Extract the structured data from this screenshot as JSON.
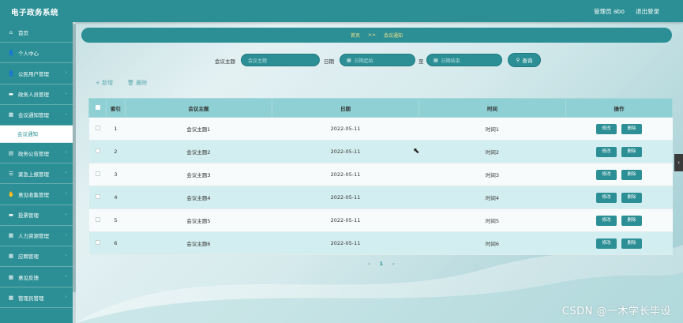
{
  "app": {
    "title": "电子政务系统",
    "admin_label": "管理员 abo",
    "logout": "退出登录"
  },
  "sidebar": {
    "items": [
      {
        "label": "首页",
        "icon": "home-icon",
        "glyph": "⌂"
      },
      {
        "label": "个人中心",
        "icon": "user-icon",
        "glyph": "👤"
      },
      {
        "label": "公民用户管理",
        "icon": "user-icon",
        "glyph": "👤"
      },
      {
        "label": "政务人员管理",
        "icon": "card-icon",
        "glyph": "▬"
      },
      {
        "label": "会议通知管理",
        "icon": "grid-icon",
        "glyph": "▦"
      },
      {
        "label": "政务公告管理",
        "icon": "book-icon",
        "glyph": "▤"
      },
      {
        "label": "紧急上报管理",
        "icon": "list-icon",
        "glyph": "☰"
      },
      {
        "label": "意见收集管理",
        "icon": "hand-icon",
        "glyph": "✋"
      },
      {
        "label": "投票管理",
        "icon": "card-icon",
        "glyph": "▬"
      },
      {
        "label": "人力资源管理",
        "icon": "grid-icon",
        "glyph": "▦"
      },
      {
        "label": "应聘管理",
        "icon": "grid-icon",
        "glyph": "▦"
      },
      {
        "label": "意见反馈",
        "icon": "grid-icon",
        "glyph": "▦"
      },
      {
        "label": "管理员管理",
        "icon": "grid-icon",
        "glyph": "▦"
      }
    ],
    "active_sub": "会议通知"
  },
  "breadcrumb": {
    "home": "首页",
    "sep": ">>",
    "current": "会议通知"
  },
  "search": {
    "topic_label": "会议主题",
    "topic_placeholder": "会议主题",
    "date_label": "日期",
    "date_start_placeholder": "日期起始",
    "to_label": "至",
    "date_end_placeholder": "日期结束",
    "query_button": "查询"
  },
  "toolbar": {
    "add_label": "+ 新增",
    "delete_label": "删除"
  },
  "table": {
    "headers": [
      "索引",
      "会议主题",
      "日期",
      "时间",
      "操作"
    ],
    "edit_label": "修改",
    "delete_label": "删除",
    "rows": [
      {
        "index": "1",
        "topic": "会议主题1",
        "date": "2022-05-11",
        "time": "时间1"
      },
      {
        "index": "2",
        "topic": "会议主题2",
        "date": "2022-05-11",
        "time": "时间2"
      },
      {
        "index": "3",
        "topic": "会议主题3",
        "date": "2022-05-11",
        "time": "时间3"
      },
      {
        "index": "4",
        "topic": "会议主题4",
        "date": "2022-05-11",
        "time": "时间4"
      },
      {
        "index": "5",
        "topic": "会议主题5",
        "date": "2022-05-11",
        "time": "时间5"
      },
      {
        "index": "6",
        "topic": "会议主题6",
        "date": "2022-05-11",
        "time": "时间6"
      }
    ]
  },
  "pagination": {
    "prev": "‹",
    "current": "1",
    "next": "›"
  },
  "watermark": "CSDN @一木学长毕设",
  "colors": {
    "primary": "#2b8f95",
    "header_row": "#8fd0d4",
    "highlight_row": "#d3eef0",
    "breadcrumb_text": "#f2e28a"
  }
}
